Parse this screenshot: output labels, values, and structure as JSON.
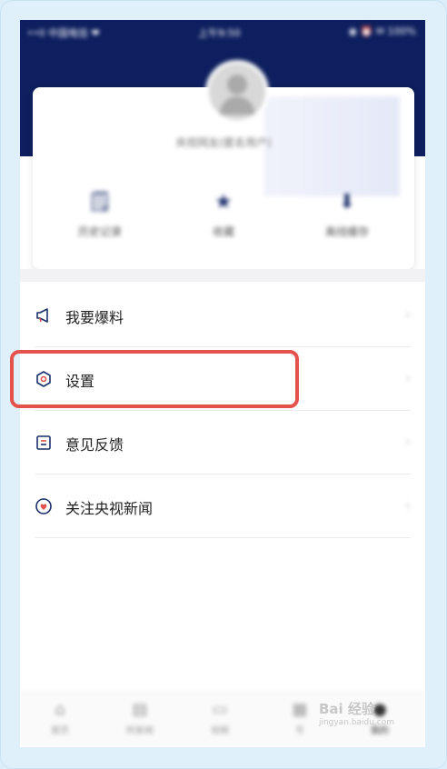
{
  "status_bar": {
    "left": "••II 中国电信 ❤",
    "center": "上午9:50",
    "right": "◉ ⏰ ✉ 100%"
  },
  "profile": {
    "username": "央视网友(匿名用户)",
    "shortcuts": [
      {
        "icon": "history-icon",
        "glyph": "🗒",
        "label": "历史记录"
      },
      {
        "icon": "star-icon",
        "glyph": "★",
        "label": "收藏"
      },
      {
        "icon": "download-icon",
        "glyph": "⬇",
        "label": "离线缓存"
      }
    ]
  },
  "menu": {
    "items": [
      {
        "icon": "megaphone-icon",
        "label": "我要爆料",
        "arrow": "›"
      },
      {
        "icon": "settings-icon",
        "label": "设置",
        "arrow": "›"
      },
      {
        "icon": "feedback-icon",
        "label": "意见反馈",
        "arrow": "›"
      },
      {
        "icon": "heart-icon",
        "label": "关注央视新闻",
        "arrow": "›"
      }
    ]
  },
  "bottom_nav": {
    "items": [
      {
        "glyph": "⌂",
        "label": "首页"
      },
      {
        "glyph": "▤",
        "label": "听新闻"
      },
      {
        "glyph": "▭",
        "label": "视频"
      },
      {
        "glyph": "▦",
        "label": "号"
      },
      {
        "glyph": "●",
        "label": "我的"
      }
    ]
  },
  "watermark": {
    "brand": "Bai 经验",
    "sub": "jingyan.baidu.com"
  },
  "colors": {
    "header": "#0d1f5e",
    "highlight": "#e5514c",
    "accent_red": "#e5514c"
  }
}
